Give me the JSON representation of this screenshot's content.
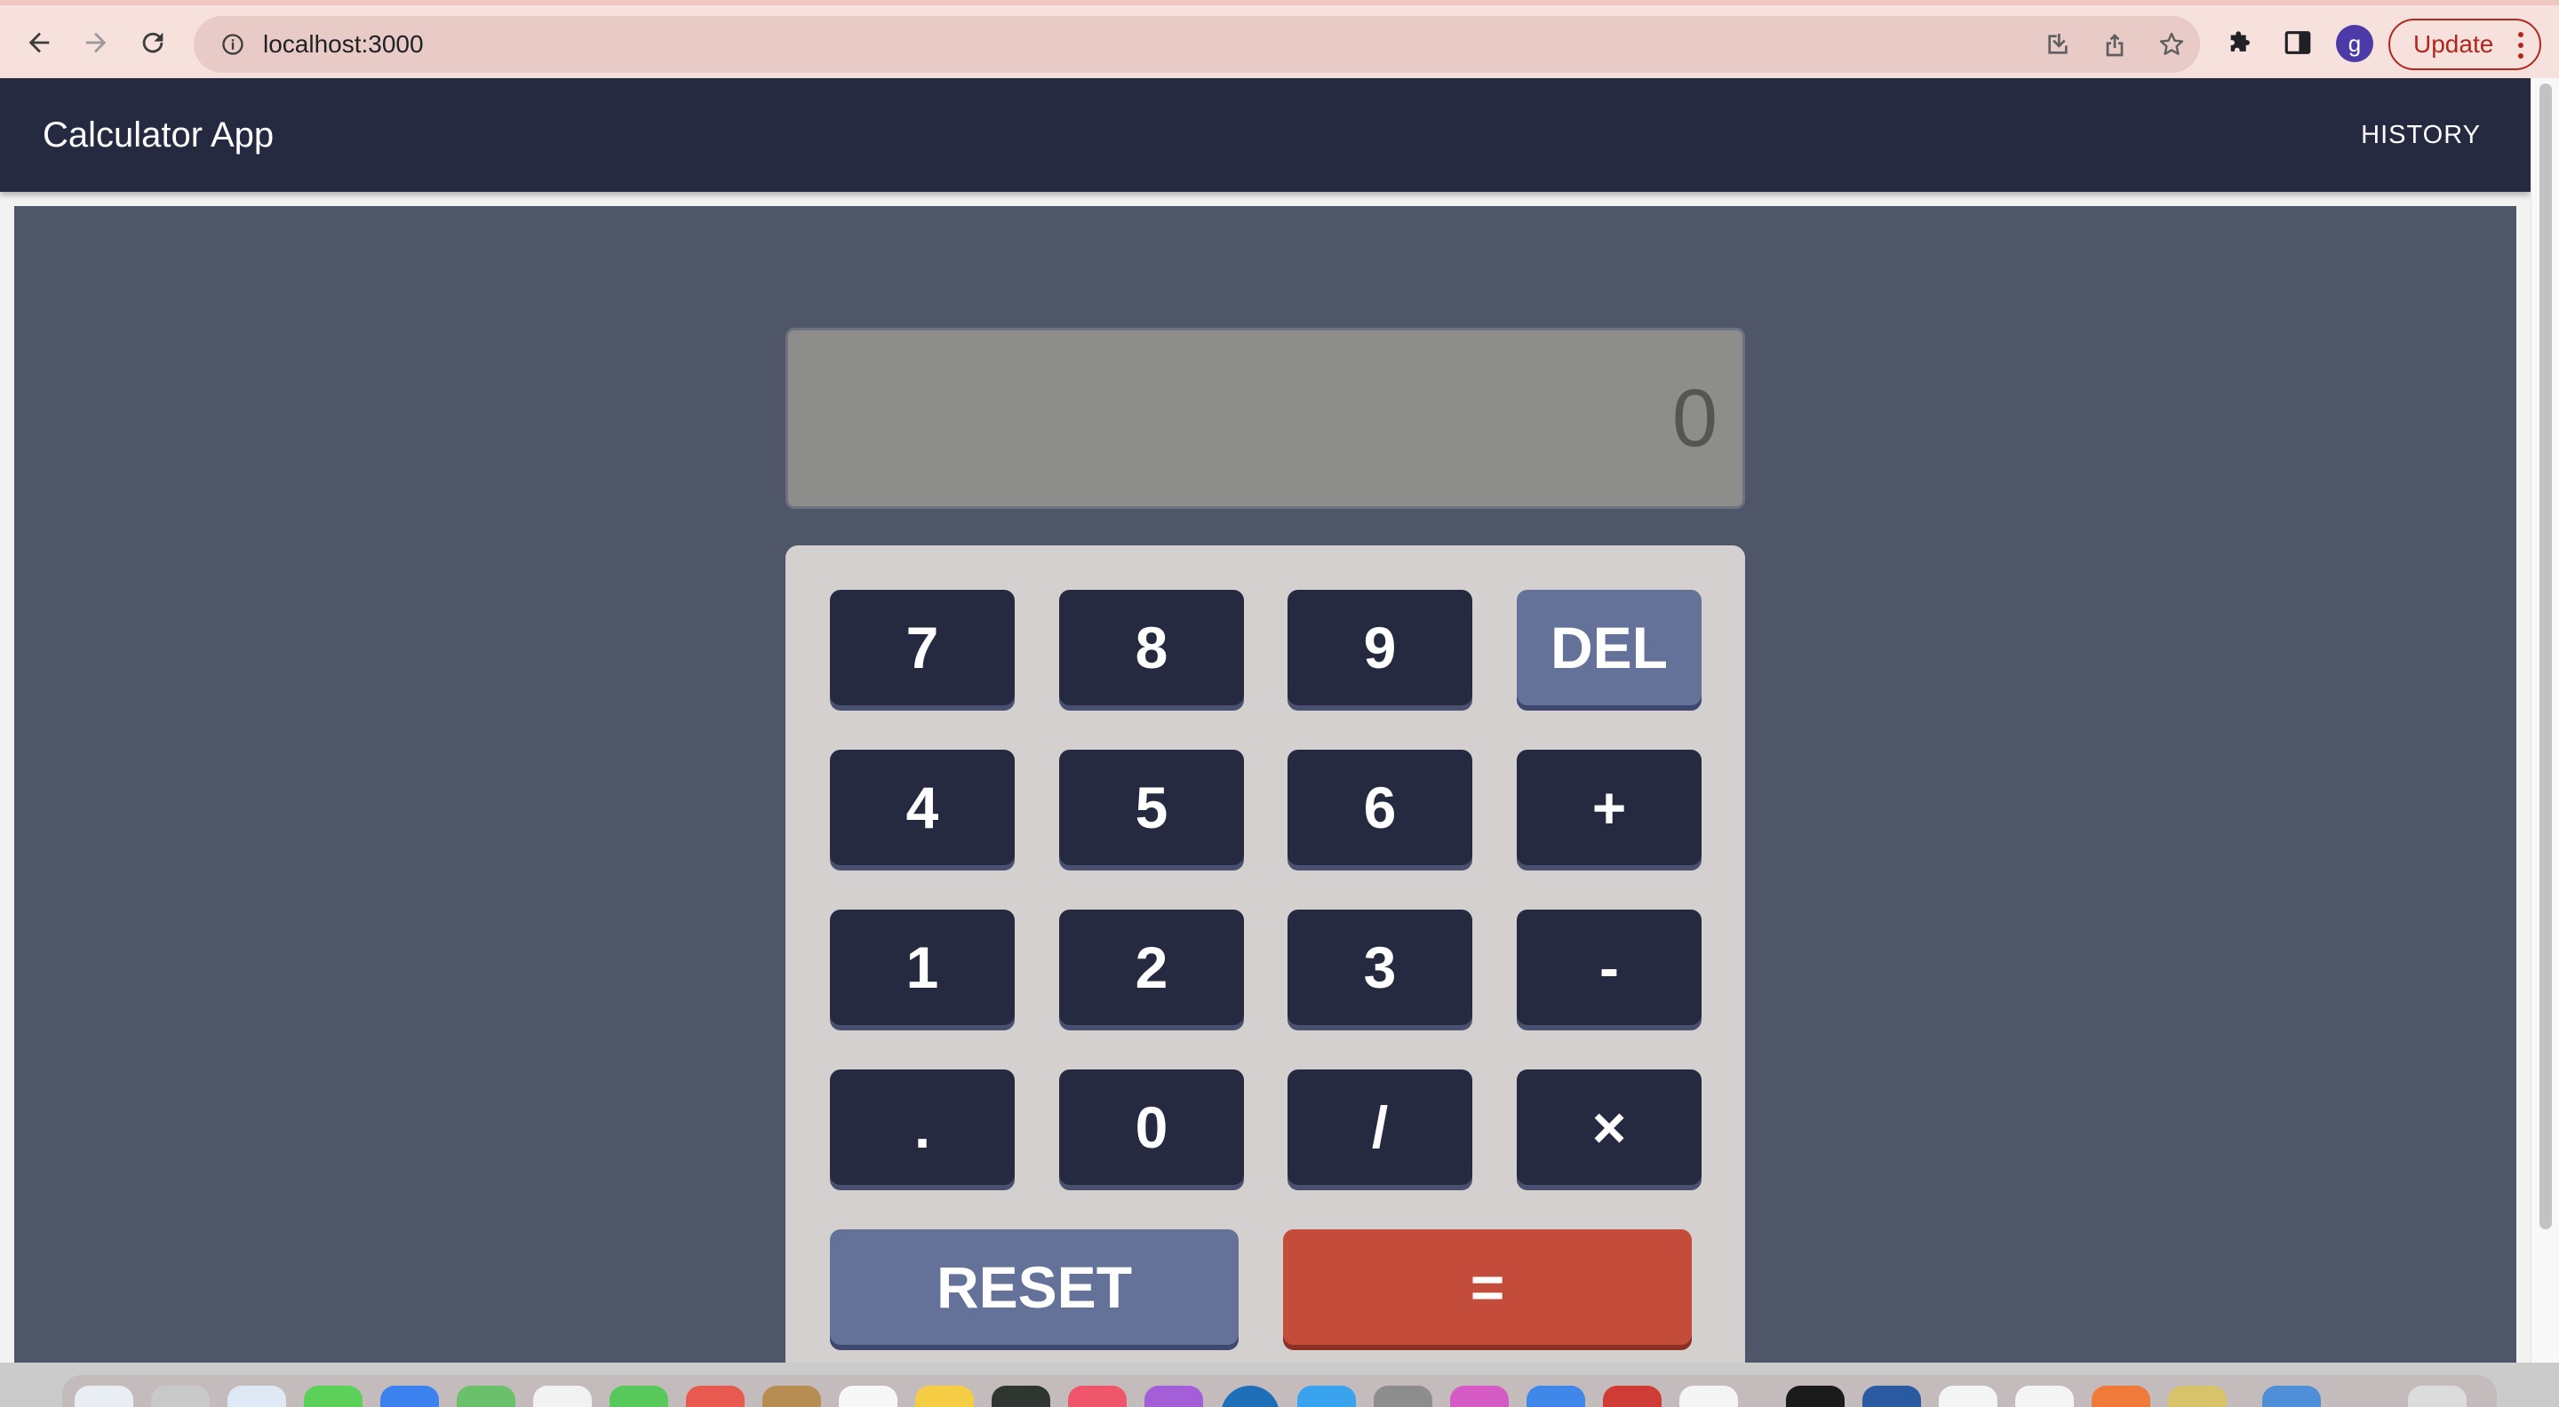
{
  "browser": {
    "url": "localhost:3000",
    "profile_initial": "g",
    "update_label": "Update",
    "icons": [
      "back-arrow-icon",
      "forward-arrow-icon",
      "reload-icon",
      "site-info-icon",
      "install-app-icon",
      "share-icon",
      "bookmark-star-icon",
      "extensions-puzzle-icon",
      "side-panel-icon",
      "kebab-menu-icon"
    ]
  },
  "app": {
    "title": "Calculator App",
    "history_label": "HISTORY"
  },
  "calculator": {
    "display": "0",
    "keys": {
      "k7": "7",
      "k8": "8",
      "k9": "9",
      "del": "DEL",
      "k4": "4",
      "k5": "5",
      "k6": "6",
      "plus": "+",
      "k1": "1",
      "k2": "2",
      "k3": "3",
      "minus": "-",
      "dot": ".",
      "k0": "0",
      "divide": "/",
      "multiply": "×",
      "reset": "RESET",
      "equals": "="
    }
  },
  "colors": {
    "appbar": "#252a41",
    "background": "#4f5668",
    "keypad": "#d4d0cf",
    "display": "#8d8d8b",
    "key": "#252a41",
    "function_key": "#647198",
    "equals_key": "#c44c3b"
  }
}
